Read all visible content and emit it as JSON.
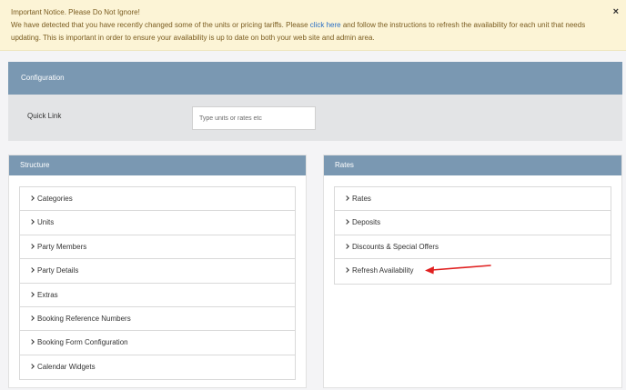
{
  "notice": {
    "title": "Important Notice. Please Do Not Ignore!",
    "body_before": "We have detected that you have recently changed some of the units or pricing tariffs. Please ",
    "link": "click here",
    "body_after": " and follow the instructions to refresh the availability for each unit that needs updating. This is important in order to ensure your availability is up to date on both your web site and admin area.",
    "close": "×"
  },
  "configuration": {
    "title": "Configuration",
    "quick_link_label": "Quick Link",
    "quick_link_placeholder": "Type units or rates etc"
  },
  "structure": {
    "title": "Structure",
    "items": [
      "Categories",
      "Units",
      "Party Members",
      "Party Details",
      "Extras",
      "Booking Reference Numbers",
      "Booking Form Configuration",
      "Calendar Widgets"
    ]
  },
  "rates": {
    "title": "Rates",
    "items": [
      "Rates",
      "Deposits",
      "Discounts & Special Offers",
      "Refresh Availability"
    ]
  },
  "colors": {
    "panel_header": "#7a98b2",
    "notice_bg": "#fcf4d6",
    "link": "#2a6fc4",
    "annotation_arrow": "#e02020"
  },
  "icons": {
    "item_chevron": "chevron-right-icon",
    "close": "close-icon",
    "annotation": "red-arrow-annotation"
  }
}
